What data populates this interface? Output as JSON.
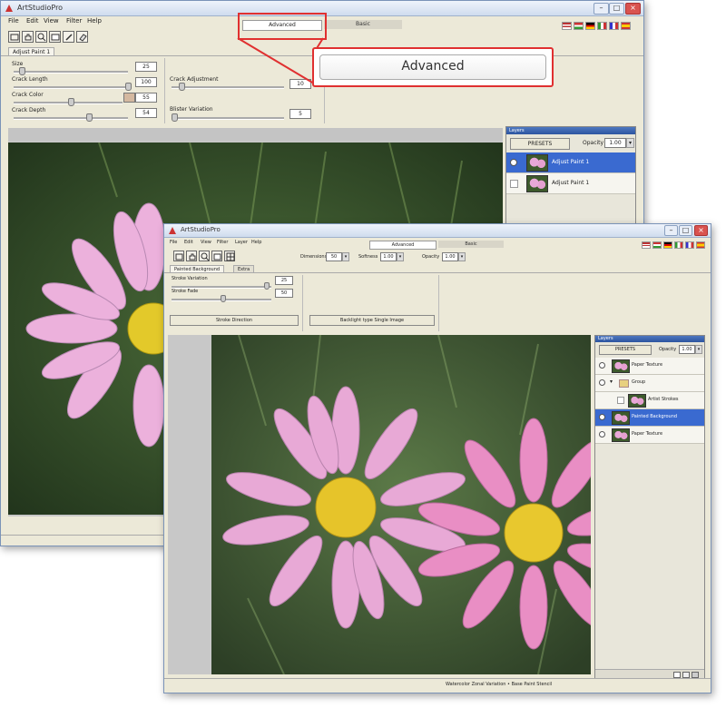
{
  "back_window": {
    "title": "ArtStudioPro",
    "menu": [
      "File",
      "Edit",
      "View",
      "Filter",
      "Help"
    ],
    "mode_tabs": {
      "advanced": "Advanced",
      "basic": "Basic"
    },
    "panel_tab": "Adjust Paint 1",
    "params_left": [
      {
        "label": "Size",
        "value": "25"
      },
      {
        "label": "Crack Length",
        "value": "100"
      },
      {
        "label": "Crack Color",
        "value": "55"
      },
      {
        "label": "Crack Depth",
        "value": "54"
      }
    ],
    "params_right": [
      {
        "label": "Crack Adjustment",
        "value": "10"
      },
      {
        "label": "Blister Variation",
        "value": "5"
      }
    ],
    "layers": {
      "header": "Layers",
      "presets_button": "PRESETS",
      "opacity_label": "Opacity",
      "opacity_value": "1.00",
      "items": [
        "Adjust Paint 1",
        "Adjust Paint 1"
      ]
    }
  },
  "callout": {
    "label": "Advanced"
  },
  "front_window": {
    "title": "ArtStudioPro",
    "menu": [
      "File",
      "Edit",
      "View",
      "Filter",
      "Layer",
      "Help"
    ],
    "mode_tabs": {
      "advanced": "Advanced",
      "basic": "Basic"
    },
    "toolbar_fields": [
      {
        "label": "Dimensions",
        "value": "50"
      },
      {
        "label": "Softness",
        "value": "1.00"
      },
      {
        "label": "Opacity",
        "value": "1.00"
      }
    ],
    "panel_tabs": [
      "Painted Background",
      "Extra"
    ],
    "params": [
      {
        "label": "Stroke Variation",
        "value": "25"
      },
      {
        "label": "Stroke Fade",
        "value": "50"
      }
    ],
    "buttons": [
      "Stroke Direction",
      "Backlight type Single Image"
    ],
    "layers": {
      "header": "Layers",
      "presets_button": "PRESETS",
      "opacity_label": "Opacity",
      "opacity_value": "1.00",
      "items": [
        "Paper Texture",
        "Group",
        "Artist Strokes",
        "Painted Background",
        "Paper Texture"
      ]
    },
    "status": "Watercolor Zonal Variation • Base Paint Stencil"
  },
  "colors": {
    "accent": "#e03030",
    "selection": "#3a6ad0",
    "titlebar": "#cfdcee"
  }
}
